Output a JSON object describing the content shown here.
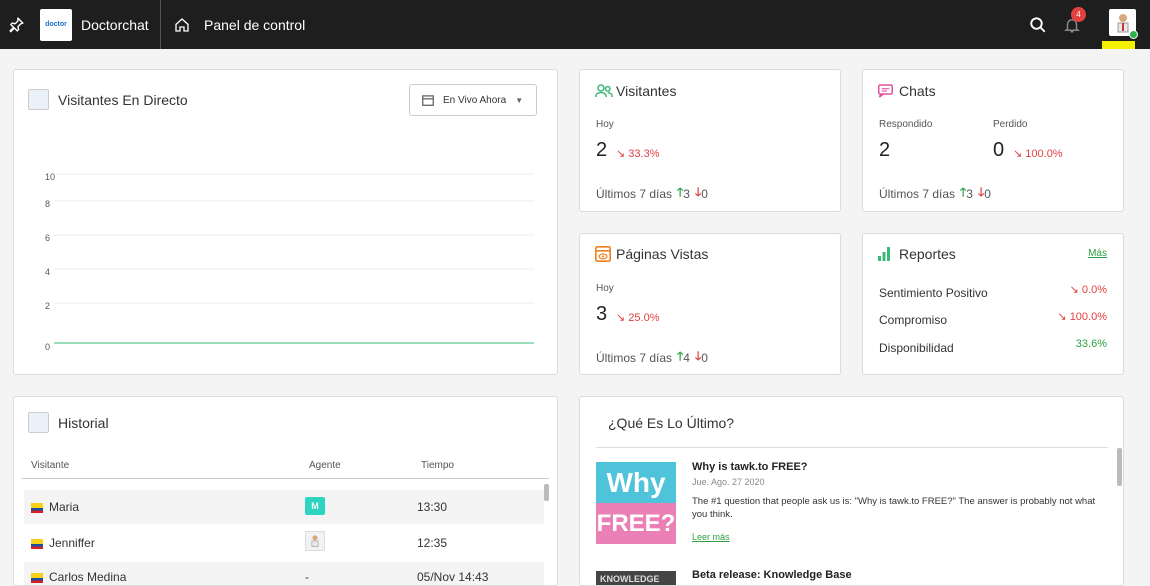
{
  "topbar": {
    "brand": "Doctorchat",
    "breadcrumb": "Panel de control",
    "notifications": "4",
    "logo_text": "doctor"
  },
  "live": {
    "title": "Visitantes En Directo",
    "dropdown": "En Vivo Ahora",
    "y_ticks": [
      "10",
      "8",
      "6",
      "4",
      "2",
      "0"
    ]
  },
  "visitors": {
    "title": "Visitantes",
    "today_label": "Hoy",
    "today_value": "2",
    "change": "33.3%",
    "last7_label": "Últimos 7 días",
    "up": "3",
    "down": "0"
  },
  "chats": {
    "title": "Chats",
    "answered_label": "Respondido",
    "answered_value": "2",
    "lost_label": "Perdido",
    "lost_value": "0",
    "change": "100.0%",
    "last7_label": "Últimos 7 días",
    "up": "3",
    "down": "0"
  },
  "pages": {
    "title": "Páginas Vistas",
    "today_label": "Hoy",
    "today_value": "3",
    "change": "25.0%",
    "last7_label": "Últimos 7 días",
    "up": "4",
    "down": "0"
  },
  "reports": {
    "title": "Reportes",
    "more": "Más",
    "items": [
      {
        "label": "Sentimiento Positivo",
        "value": "0.0%"
      },
      {
        "label": "Compromiso",
        "value": "100.0%"
      },
      {
        "label": "Disponibilidad",
        "value": "33.6%"
      }
    ]
  },
  "history": {
    "title": "Historial",
    "columns": [
      "Visitante",
      "Agente",
      "Tiempo"
    ],
    "rows": [
      {
        "visitor": "Maria",
        "agent": "M",
        "time": "13:30"
      },
      {
        "visitor": "Jenniffer",
        "agent": "",
        "time": "12:35"
      },
      {
        "visitor": "Carlos Medina",
        "agent": "-",
        "time": "05/Nov 14:43"
      }
    ]
  },
  "news": {
    "title": "¿Qué Es Lo Último?",
    "items": [
      {
        "title": "Why is tawk.to FREE?",
        "date": "Jue. Ago. 27 2020",
        "body": "The #1 question that people ask us is: \"Why is tawk.to FREE?\" The answer is probably not what you think.",
        "link": "Leer más",
        "thumb_top": "Why",
        "thumb_bottom": "FREE?"
      },
      {
        "title": "Beta release: Knowledge Base",
        "thumb_top": "KNOWLEDGE"
      }
    ]
  },
  "colors": {
    "topbar": "#1e1e1e",
    "accent_green": "#2ea043",
    "accent_red": "#e34040",
    "visitors_icon": "#3cb878",
    "chats_icon": "#e0529c",
    "pages_icon": "#f07f1f",
    "reports_icon": "#3cb878"
  }
}
